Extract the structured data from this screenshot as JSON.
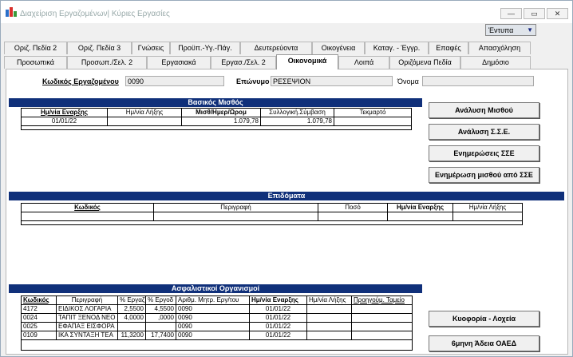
{
  "window": {
    "title": "Διαχείριση Εργαζομένων| Κύριες Εργασίες"
  },
  "printer": {
    "value": "Έντυπα"
  },
  "tabs_row1": [
    "Οριζ. Πεδία 2",
    "Οριζ. Πεδία 3",
    "Γνώσεις",
    "Προϋπ.-Υγ.-Πάγ.",
    "Δευτερεύοντα",
    "Οικογένεια",
    "Καταγ. - Έγγρ.",
    "Επαφές",
    "Απασχόληση"
  ],
  "tabs_row2": [
    "Προσωπικά",
    "Προσωπ./Σελ. 2",
    "Εργασιακά",
    "Εργασ./Σελ. 2",
    "Οικονομικά",
    "Λοιπά",
    "Οριζόμενα Πεδία",
    "Δημόσιο"
  ],
  "employee": {
    "code_label": "Κωδικός Εργαζομένου",
    "code_value": "0090",
    "surname_label": "Επώνυμο",
    "surname_value": "ΡΕΣΕΨΙΟΝ",
    "name_label": "Όνομα",
    "name_value": ""
  },
  "basic_salary": {
    "title": "Βασικός Μισθός",
    "headers": [
      "Ημ/νία Εναρξης",
      "Ημ/νία Λήξης",
      "Μισθ/Ημερ/Ωρομ",
      "Συλλογική.Σύμβαση",
      "Τεκμαρτό"
    ],
    "rows": [
      [
        "01/01/22",
        "",
        "1.079,78",
        "1.079,78",
        ""
      ]
    ]
  },
  "allowances": {
    "title": "Επιδόματα",
    "headers": [
      "Κωδικός",
      "Περιγραφή",
      "Ποσό",
      "Ημ/νία Εναρξης",
      "Ημ/νία Λήξης"
    ]
  },
  "insurance": {
    "title": "Ασφαλιστικοί Οργανισμοί",
    "headers": [
      "Κωδικός",
      "Περιγραφή",
      "% Εργαζ",
      "% Εργοδ",
      "Αριθμ. Μητρ. Εργ/του",
      "Ημ/νία Εναρξης",
      "Ημ/νία Λήξης",
      "Προηγούμ. Ταμείο"
    ],
    "rows": [
      [
        "4172",
        "ΕΙΔΙΚΟΣ ΛΟΓΑΡΙΑ",
        "2,5500",
        "4,5500",
        "0090",
        "01/01/22",
        "",
        ""
      ],
      [
        "0024",
        "ΤΑΠΙΤ ΞΕΝΟΔ ΝΕΟ",
        "4,0000",
        ",0000",
        "0090",
        "01/01/22",
        "",
        ""
      ],
      [
        "0025",
        "ΕΦΑΠΑΞ ΕΙΣΦΟΡΑ",
        "",
        "",
        "0090",
        "01/01/22",
        "",
        ""
      ],
      [
        "0109",
        "ΙΚΑ ΣΥΝΤΑΞΗ ΤΕΑ",
        "11,3200",
        "17,7400",
        "0090",
        "01/01/22",
        "",
        ""
      ]
    ]
  },
  "buttons": {
    "salary_analysis": "Ανάλυση Μισθού",
    "sse_analysis": "Ανάλυση Σ.Σ.Ε.",
    "sse_updates": "Ενημερώσεις ΣΣΕ",
    "update_from_sse": "Ενημέρωση μισθού από ΣΣΕ",
    "maternity": "Κυοφορία - Λοχεία",
    "oaed_leave": "6μηνη Άδεια ΟΑΕΔ"
  }
}
